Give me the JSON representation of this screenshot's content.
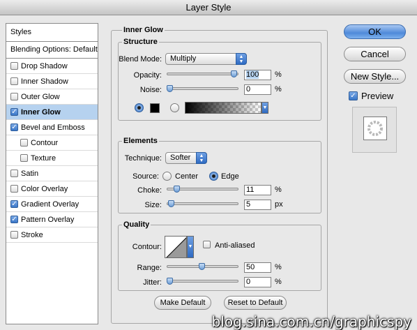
{
  "window": {
    "title": "Layer Style"
  },
  "style_list": {
    "header": "Styles",
    "blending": "Blending Options: Default",
    "items": [
      {
        "label": "Drop Shadow",
        "checked": false
      },
      {
        "label": "Inner Shadow",
        "checked": false
      },
      {
        "label": "Outer Glow",
        "checked": false
      },
      {
        "label": "Inner Glow",
        "checked": true,
        "selected": true
      },
      {
        "label": "Bevel and Emboss",
        "checked": true
      },
      {
        "label": "Contour",
        "checked": false,
        "indent": true
      },
      {
        "label": "Texture",
        "checked": false,
        "indent": true
      },
      {
        "label": "Satin",
        "checked": false
      },
      {
        "label": "Color Overlay",
        "checked": false
      },
      {
        "label": "Gradient Overlay",
        "checked": true
      },
      {
        "label": "Pattern Overlay",
        "checked": true
      },
      {
        "label": "Stroke",
        "checked": false
      }
    ]
  },
  "panel": {
    "title": "Inner Glow",
    "structure": {
      "title": "Structure",
      "blend_mode_label": "Blend Mode:",
      "blend_mode_value": "Multiply",
      "opacity_label": "Opacity:",
      "opacity_value": "100",
      "opacity_level": 1.0,
      "noise_label": "Noise:",
      "noise_value": "0",
      "noise_level": 0.0,
      "percent": "%",
      "glow_mode": "color",
      "glow_color": "#000000"
    },
    "elements": {
      "title": "Elements",
      "technique_label": "Technique:",
      "technique_value": "Softer",
      "source_label": "Source:",
      "source_center": "Center",
      "source_edge": "Edge",
      "source_selected": "Edge",
      "choke_label": "Choke:",
      "choke_value": "11",
      "choke_level": 0.11,
      "size_label": "Size:",
      "size_value": "5",
      "size_level": 0.02,
      "px": "px",
      "percent": "%"
    },
    "quality": {
      "title": "Quality",
      "contour_label": "Contour:",
      "anti_aliased_label": "Anti-aliased",
      "anti_aliased": false,
      "range_label": "Range:",
      "range_value": "50",
      "range_level": 0.5,
      "jitter_label": "Jitter:",
      "jitter_value": "0",
      "jitter_level": 0.0,
      "percent": "%"
    },
    "make_default": "Make Default",
    "reset_default": "Reset to Default"
  },
  "buttons": {
    "ok": "OK",
    "cancel": "Cancel",
    "new_style": "New Style...",
    "preview_label": "Preview",
    "preview_checked": true
  },
  "watermark": "blog.sina.com.cn/graphicspy"
}
